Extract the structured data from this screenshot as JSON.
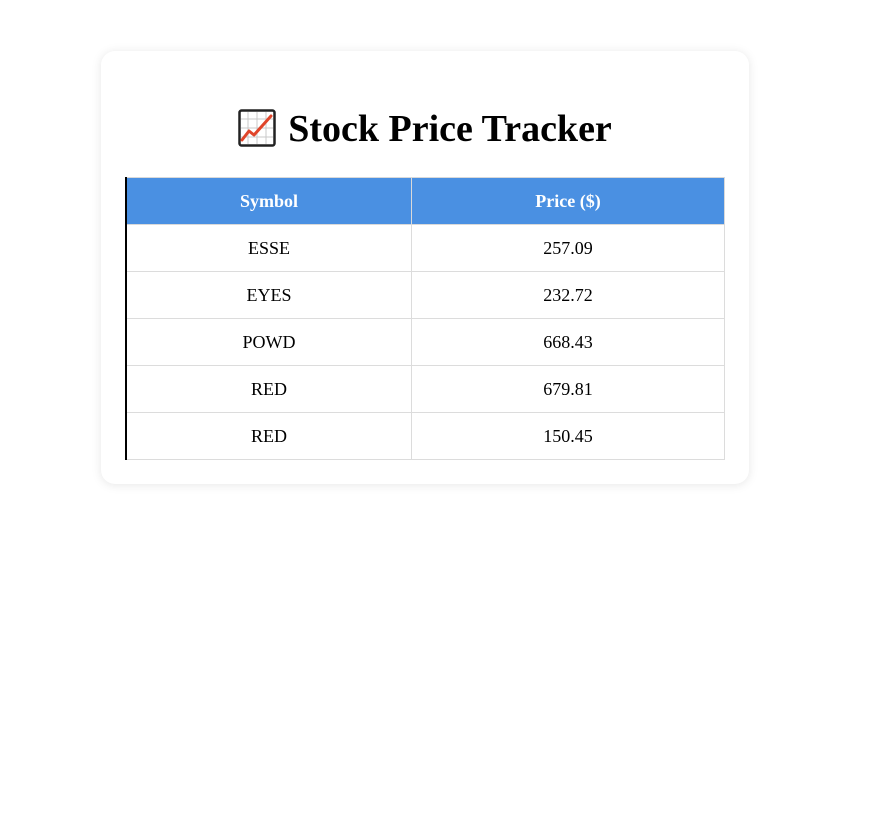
{
  "header": {
    "icon": "chart-increasing-icon",
    "title": "Stock Price Tracker"
  },
  "table": {
    "columns": [
      "Symbol",
      "Price ($)"
    ],
    "rows": [
      {
        "symbol": "ESSE",
        "price": "257.09"
      },
      {
        "symbol": "EYES",
        "price": "232.72"
      },
      {
        "symbol": "POWD",
        "price": "668.43"
      },
      {
        "symbol": "RED",
        "price": "679.81"
      },
      {
        "symbol": "RED",
        "price": "150.45"
      }
    ]
  },
  "colors": {
    "header_bg": "#4a90e2",
    "header_text": "#ffffff",
    "chart_line": "#e0452a"
  }
}
